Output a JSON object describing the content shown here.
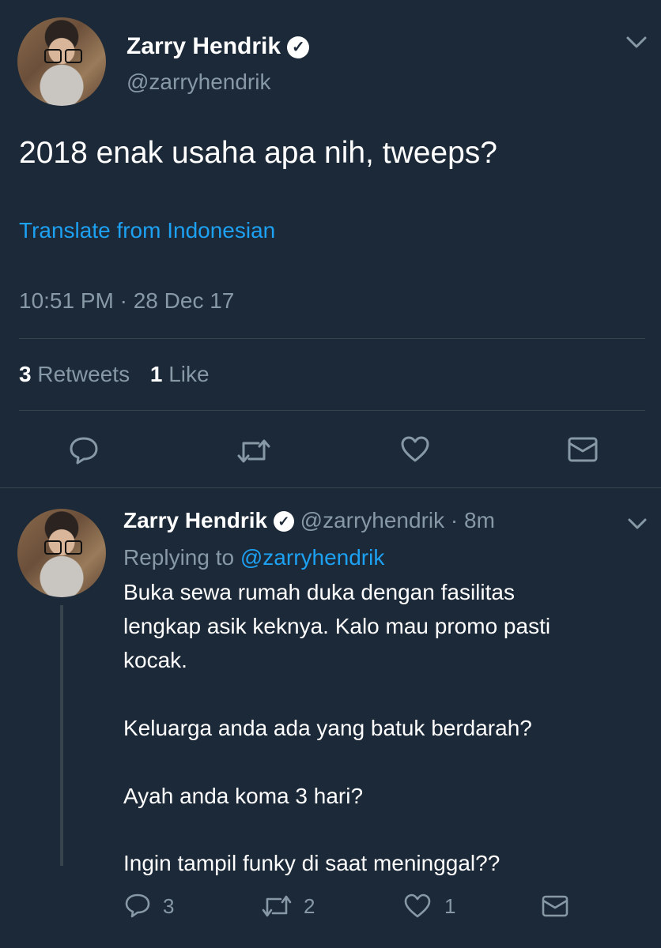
{
  "tweet": {
    "author_name": "Zarry Hendrik",
    "author_handle": "@zarryhendrik",
    "text": "2018 enak usaha apa nih, tweeps?",
    "translate_label": "Translate from Indonesian",
    "timestamp": "10:51 PM · 28 Dec 17",
    "stats": {
      "retweets_count": "3",
      "retweets_label": "Retweets",
      "likes_count": "1",
      "likes_label": "Like"
    }
  },
  "reply": {
    "author_name": "Zarry Hendrik",
    "author_handle": "@zarryhendrik",
    "time": "· 8m",
    "replying_prefix": "Replying to",
    "replying_handle": "@zarryhendrik",
    "lines": [
      "Buka sewa rumah duka dengan fasilitas",
      "lengkap asik keknya. Kalo mau promo pasti",
      "kocak.",
      "Keluarga anda ada yang batuk berdarah?",
      "Ayah anda koma 3 hari?",
      "Ingin tampil funky di saat meninggal??"
    ],
    "reply_count": "3",
    "retweet_count": "2",
    "like_count": "1"
  },
  "icons": {
    "reply": "comment-bubble-icon",
    "retweet": "retweet-arrows-icon",
    "like": "heart-icon",
    "dm": "envelope-icon",
    "more": "chevron-down-icon",
    "verified": "verified-badge-icon"
  },
  "colors": {
    "background": "#1c2938",
    "text": "#ffffff",
    "muted": "#8899a6",
    "link": "#1da1f2",
    "divider": "#38444d"
  }
}
